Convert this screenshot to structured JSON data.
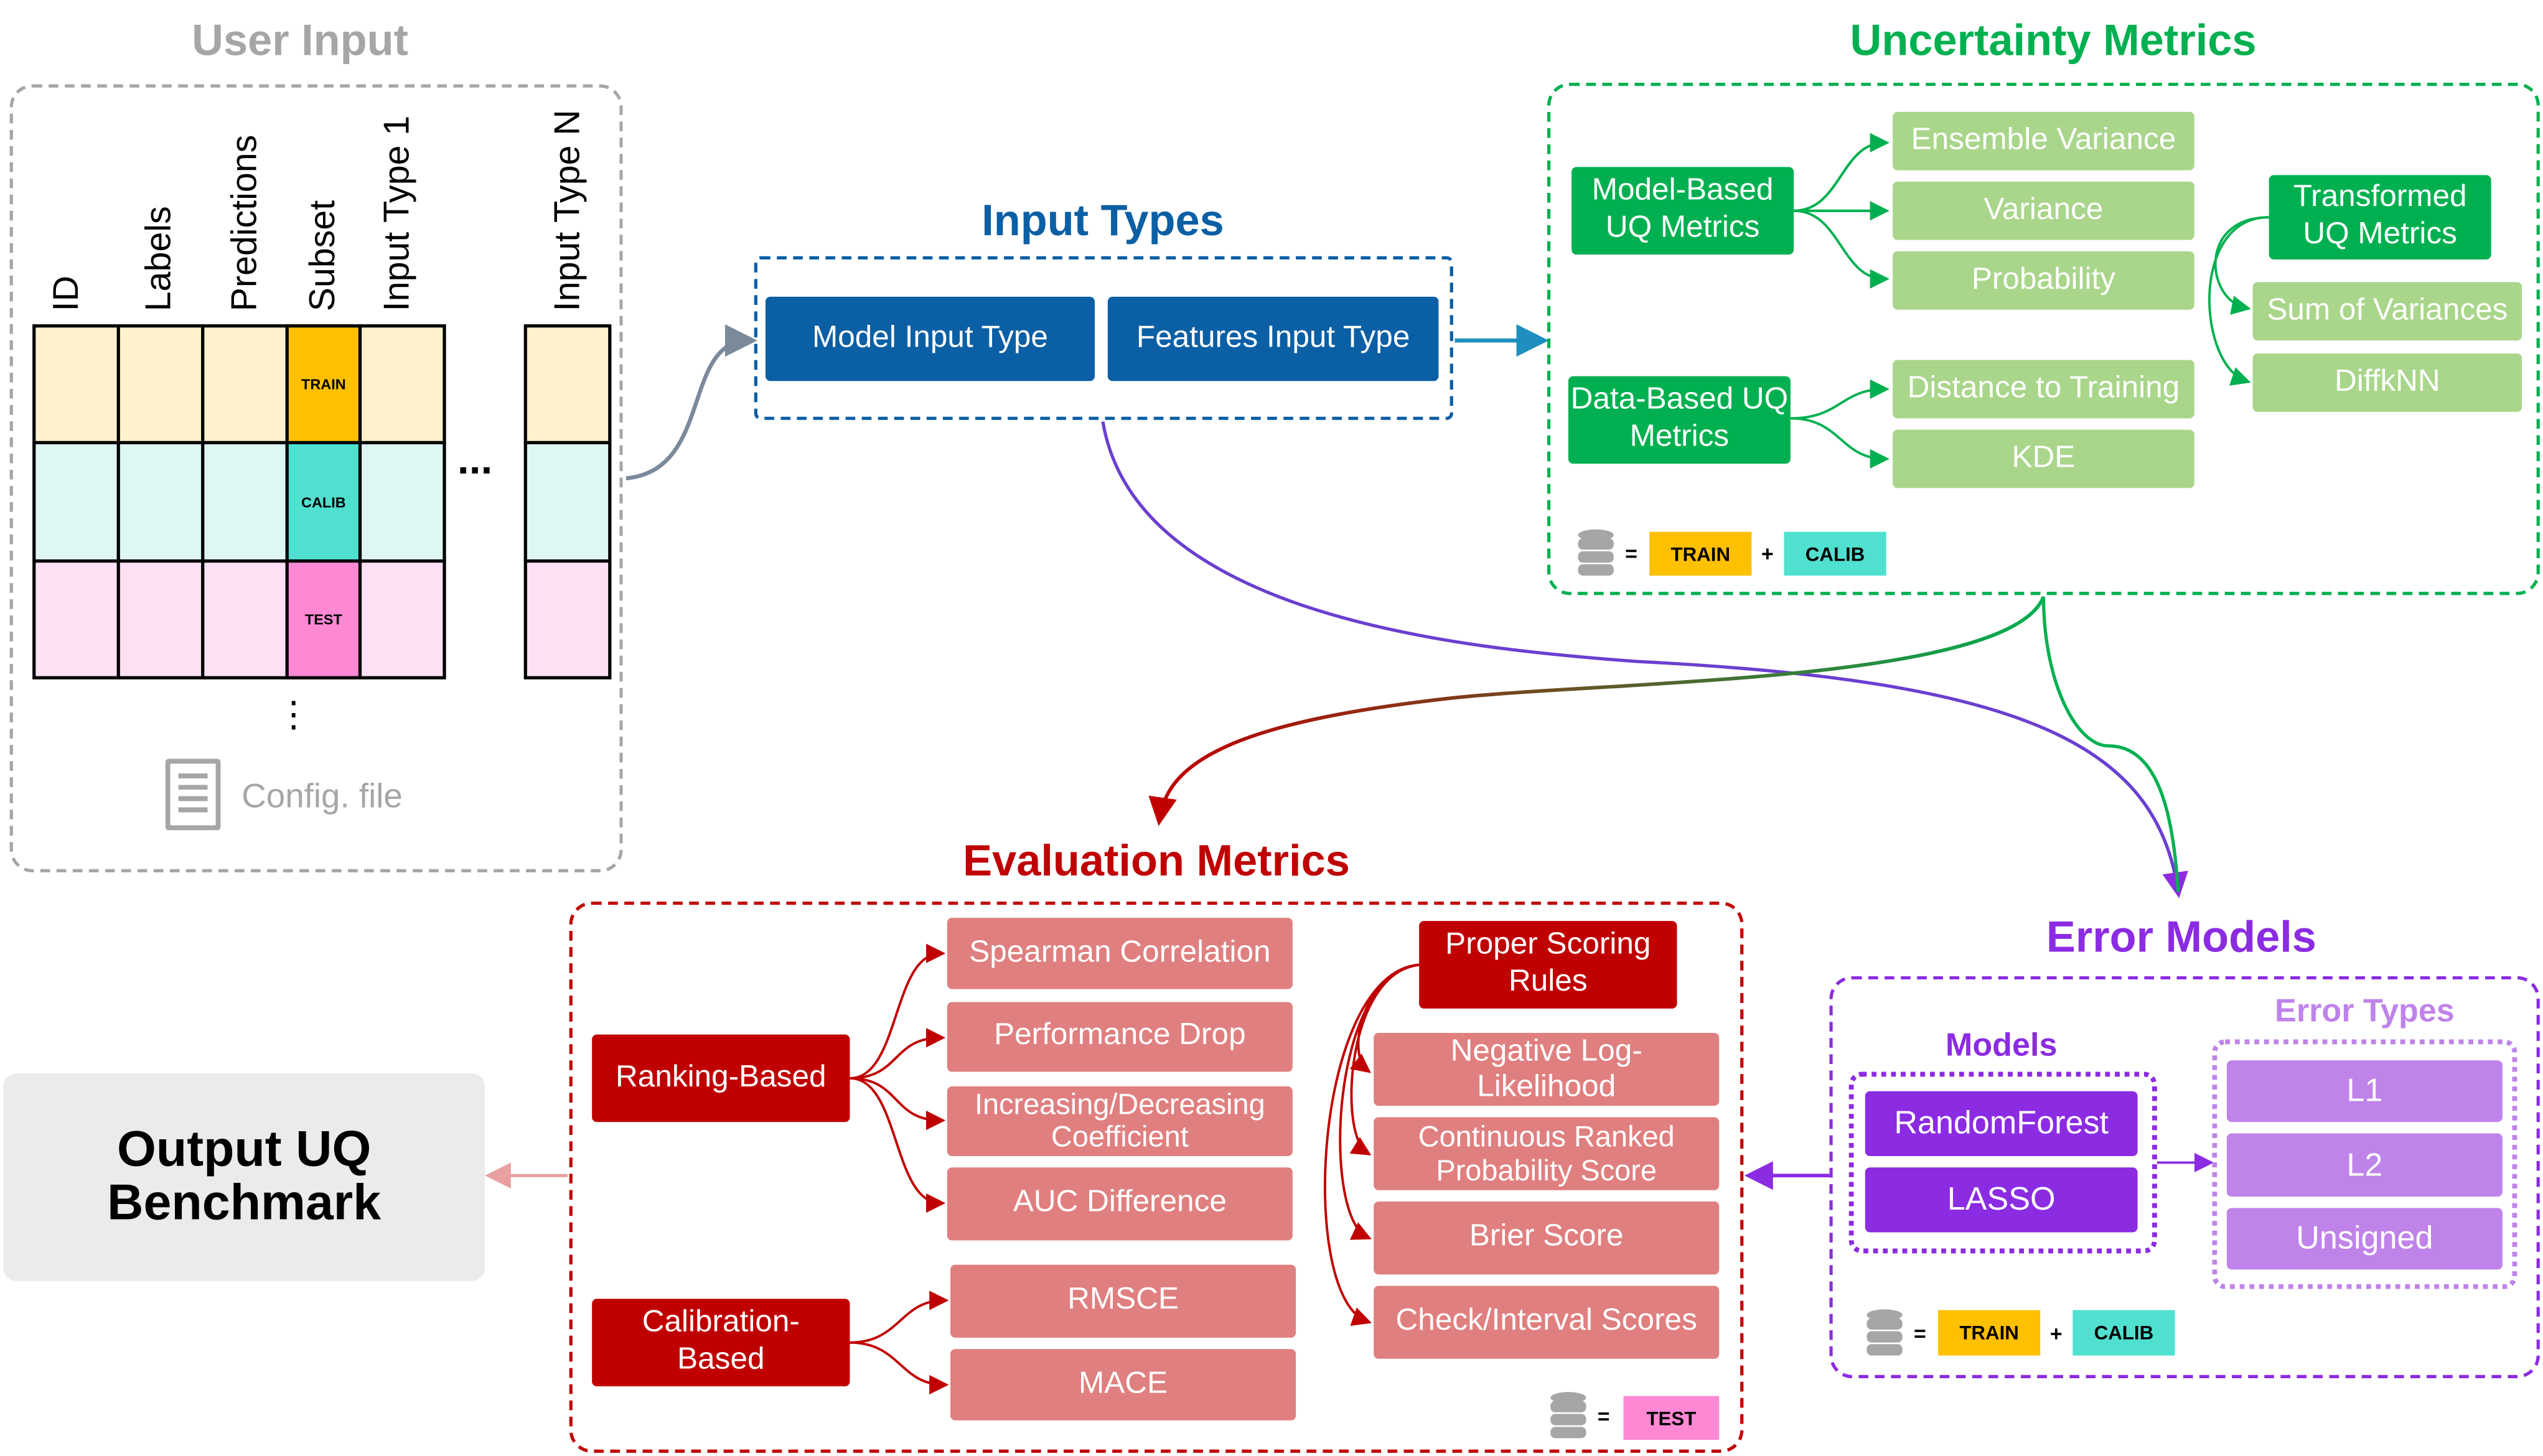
{
  "user_input": {
    "title": "User Input",
    "columns": [
      "ID",
      "Labels",
      "Predictions",
      "Subset",
      "Input Type 1",
      "Input Type N"
    ],
    "subsets": [
      "TRAIN",
      "CALIB",
      "TEST"
    ],
    "ellipsis": "...",
    "vertical_ellipsis": "⋮",
    "config_file": "Config. file"
  },
  "input_types": {
    "title": "Input Types",
    "items": [
      "Model Input Type",
      "Features Input Type"
    ]
  },
  "uncertainty_metrics": {
    "title": "Uncertainty Metrics",
    "model_based": "Model-Based UQ Metrics",
    "model_items": [
      "Ensemble Variance",
      "Variance",
      "Probability"
    ],
    "transformed": "Transformed UQ Metrics",
    "transformed_items": [
      "Sum of Variances",
      "DiffkNN"
    ],
    "data_based": "Data-Based UQ Metrics",
    "data_items": [
      "Distance to Training",
      "KDE"
    ],
    "legend": {
      "eq": "=",
      "a": "TRAIN",
      "plus": "+",
      "b": "CALIB"
    }
  },
  "evaluation_metrics": {
    "title": "Evaluation Metrics",
    "ranking": "Ranking-Based",
    "ranking_items": [
      "Spearman Correlation",
      "Performance Drop",
      "Increasing/Decreasing Coefficient",
      "AUC Difference"
    ],
    "calibration": "Calibration-Based",
    "calibration_items": [
      "RMSCE",
      "MACE"
    ],
    "proper": "Proper Scoring Rules",
    "proper_items": [
      "Negative Log-Likelihood",
      "Continuous Ranked Probability Score",
      "Brier Score",
      "Check/Interval Scores"
    ],
    "legend": {
      "eq": "=",
      "a": "TEST"
    }
  },
  "output": {
    "title": "Output UQ Benchmark"
  },
  "error_models": {
    "title": "Error Models",
    "models_title": "Models",
    "models": [
      "RandomForest",
      "LASSO"
    ],
    "types_title": "Error Types",
    "types": [
      "L1",
      "L2",
      "Unsigned"
    ],
    "legend": {
      "eq": "=",
      "a": "TRAIN",
      "plus": "+",
      "b": "CALIB"
    }
  },
  "colors": {
    "train": "#ffc000",
    "calib": "#4fe0d0",
    "test": "#ff88d5",
    "blue": "#0b5fa5",
    "green": "#00b050",
    "light_green": "#a9d68a",
    "red": "#c00000",
    "light_red": "#e07f7f",
    "purple": "#8b2be2",
    "light_purple": "#bf83ea",
    "gray": "#a6a6a6"
  }
}
